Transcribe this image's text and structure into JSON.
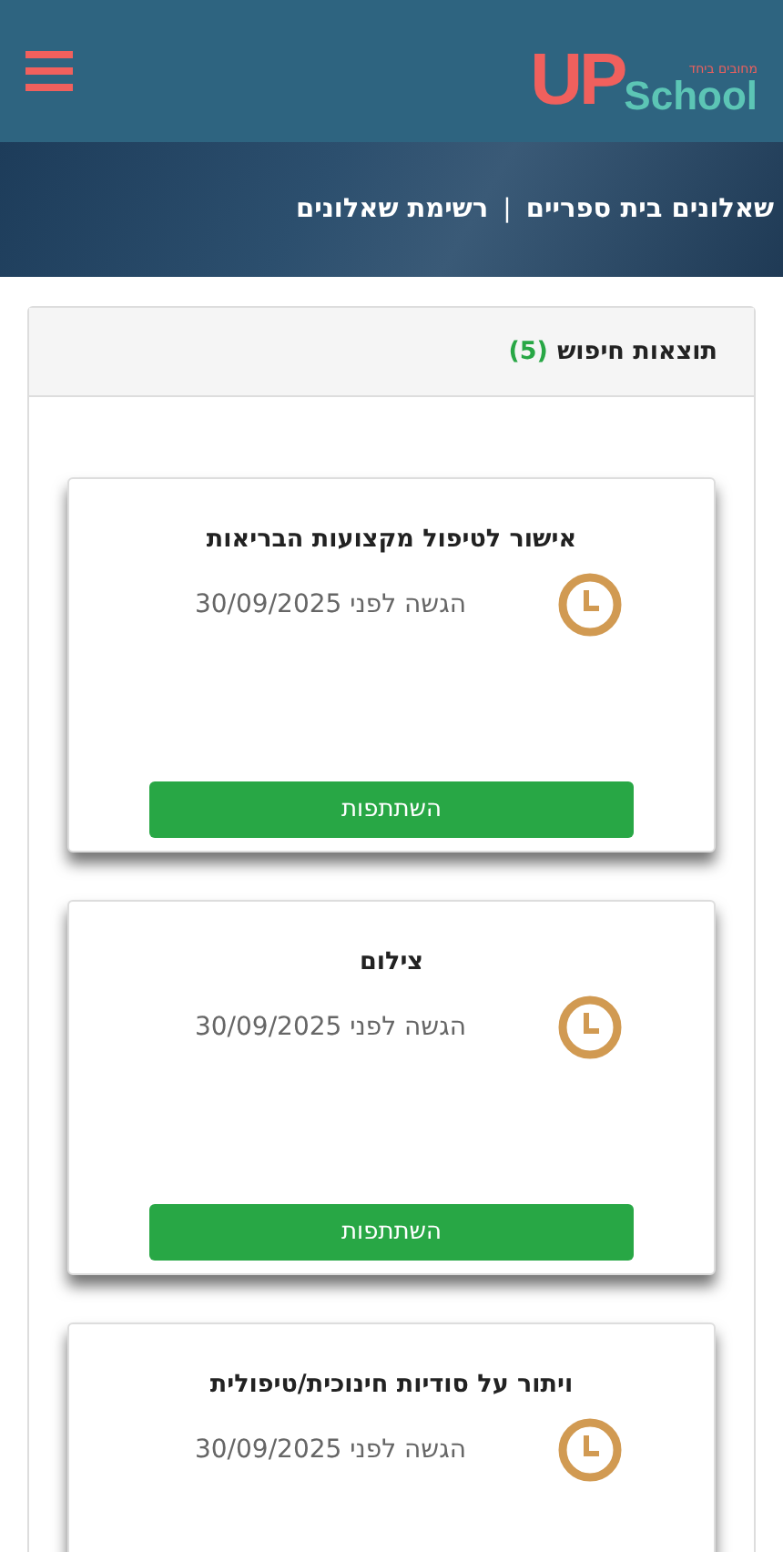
{
  "header": {
    "logo": {
      "big": "UP",
      "word": "School",
      "tagline": "מחובים ביחד"
    }
  },
  "breadcrumb": {
    "items": [
      "שאלונים בית ספריים",
      "רשימת שאלונים"
    ],
    "separator": "|"
  },
  "results": {
    "title": "תוצאות חיפוש",
    "count": "(5)",
    "cards": [
      {
        "title": "אישור לטיפול מקצועות הבריאות",
        "due": "הגשה לפני 30/09/2025",
        "button": "השתתפות"
      },
      {
        "title": "צילום",
        "due": "הגשה לפני 30/09/2025",
        "button": "השתתפות"
      },
      {
        "title": "ויתור על סודיות חינוכית/טיפולית",
        "due": "הגשה לפני 30/09/2025"
      }
    ]
  }
}
